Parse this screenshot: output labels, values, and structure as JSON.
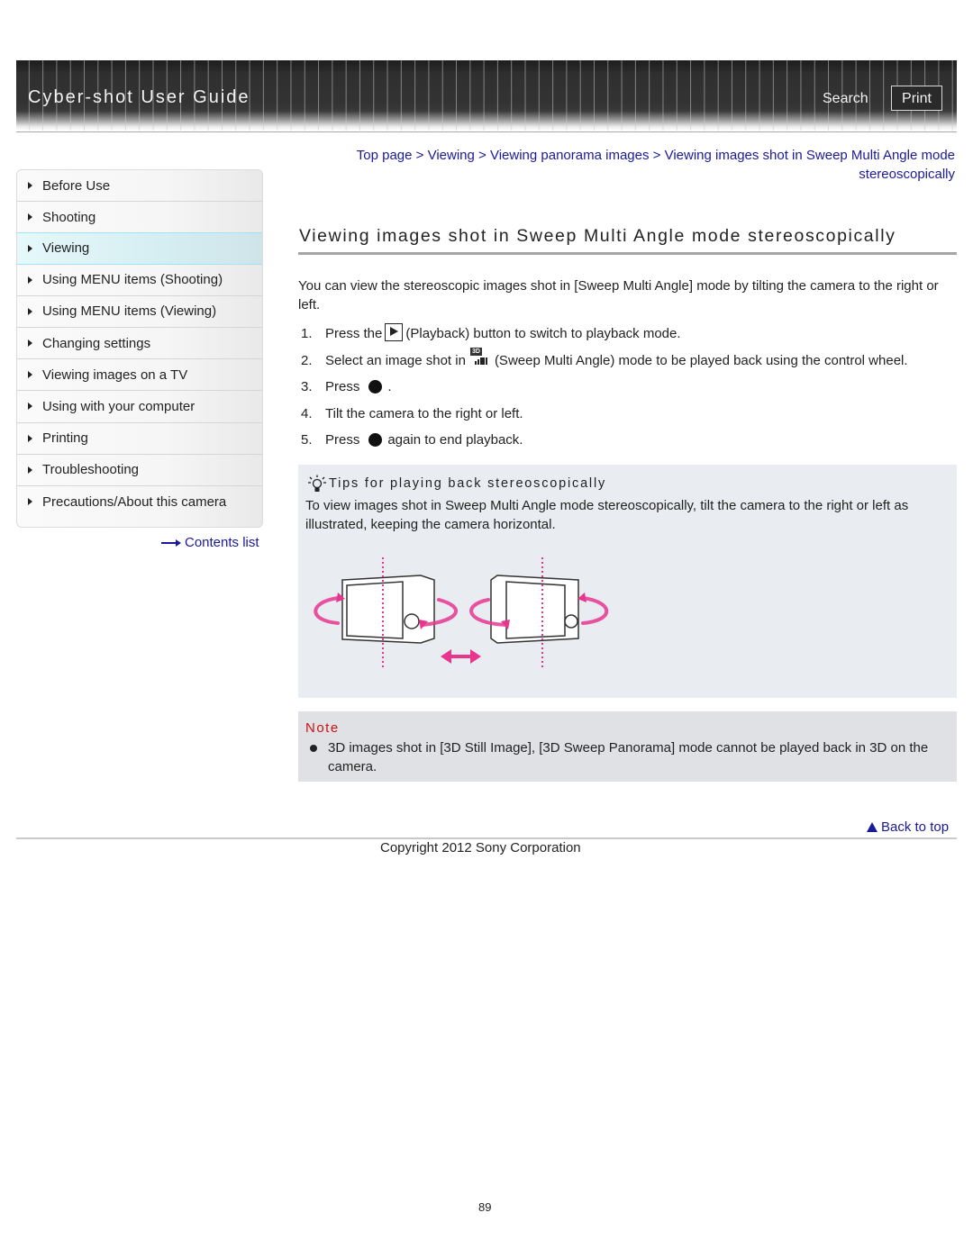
{
  "header": {
    "title": "Cyber-shot User Guide",
    "search_label": "Search",
    "print_label": "Print"
  },
  "sidebar": {
    "items": [
      {
        "label": "Before Use",
        "active": false
      },
      {
        "label": "Shooting",
        "active": false
      },
      {
        "label": "Viewing",
        "active": true
      },
      {
        "label": "Using MENU items (Shooting)",
        "active": false
      },
      {
        "label": "Using MENU items (Viewing)",
        "active": false
      },
      {
        "label": "Changing settings",
        "active": false
      },
      {
        "label": "Viewing images on a TV",
        "active": false
      },
      {
        "label": "Using with your computer",
        "active": false
      },
      {
        "label": "Printing",
        "active": false
      },
      {
        "label": "Troubleshooting",
        "active": false
      },
      {
        "label": "Precautions/About this camera",
        "active": false
      }
    ],
    "contents_list_label": "Contents list"
  },
  "breadcrumb": {
    "items": [
      "Top page",
      "Viewing",
      "Viewing panorama images",
      "Viewing images shot in Sweep Multi Angle mode stereoscopically"
    ],
    "separator": " > "
  },
  "main": {
    "title": "Viewing images shot in Sweep Multi Angle mode stereoscopically",
    "intro": "You can view the stereoscopic images shot in [Sweep Multi Angle] mode by tilting the camera to the right or left.",
    "steps": [
      {
        "num": "1.",
        "before": "Press the",
        "icon": "playback-icon",
        "after": "(Playback) button to switch to playback mode."
      },
      {
        "num": "2.",
        "before": "Select an image shot in",
        "icon": "sweep-multi-angle-icon",
        "after": "(Sweep Multi Angle) mode to be played back using the control wheel."
      },
      {
        "num": "3.",
        "before": "Press",
        "icon": "center-button-icon",
        "after": "."
      },
      {
        "num": "4.",
        "before": "Tilt the camera to the right or left.",
        "icon": "",
        "after": ""
      },
      {
        "num": "5.",
        "before": "Press",
        "icon": "center-button-icon",
        "after": "again to end playback."
      }
    ],
    "sweep_badge": "3D"
  },
  "tips": {
    "title": "Tips for playing back stereoscopically",
    "text": "To view images shot in Sweep Multi Angle mode stereoscopically, tilt the camera to the right or left as illustrated, keeping the camera horizontal.",
    "accent_color": "#e8368f"
  },
  "note": {
    "title": "Note",
    "items": [
      "3D images shot in [3D Still Image], [3D Sweep Panorama] mode cannot be played back in 3D on the camera."
    ],
    "title_color": "#cc1111"
  },
  "footer": {
    "back_to_top": "Back to top",
    "copyright": "Copyright 2012 Sony Corporation",
    "page_number": "89"
  },
  "colors": {
    "link": "#1a1a99",
    "active_nav_border": "#9fe4f3"
  }
}
